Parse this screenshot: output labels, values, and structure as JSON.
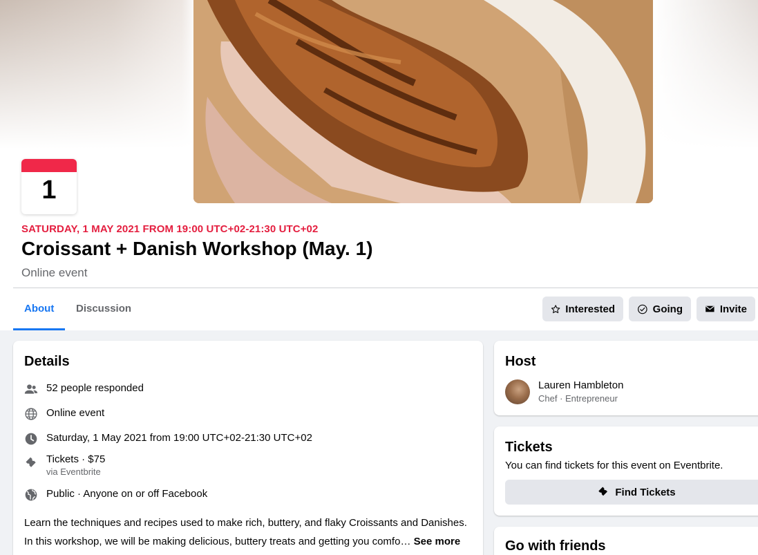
{
  "event": {
    "calendar_day": "1",
    "date_line": "SATURDAY, 1 MAY 2021 FROM 19:00 UTC+02-21:30 UTC+02",
    "title": "Croissant + Danish Workshop (May. 1)",
    "type": "Online event",
    "cover_icon": "croissant-cover-photo"
  },
  "tabs": [
    {
      "label": "About",
      "active": true
    },
    {
      "label": "Discussion",
      "active": false
    }
  ],
  "actions": {
    "interested": {
      "label": "Interested",
      "icon": "star-icon"
    },
    "going": {
      "label": "Going",
      "icon": "check-circle-icon"
    },
    "invite": {
      "label": "Invite",
      "icon": "envelope-icon"
    }
  },
  "details": {
    "title": "Details",
    "rows": [
      {
        "icon": "people-icon",
        "text": "52 people responded"
      },
      {
        "icon": "globe-icon",
        "text": "Online event"
      },
      {
        "icon": "clock-icon",
        "text": "Saturday, 1 May 2021 from 19:00 UTC+02-21:30 UTC+02"
      },
      {
        "icon": "ticket-icon",
        "text": "Tickets · $75",
        "sub": "via Eventbrite"
      },
      {
        "icon": "public-globe-icon",
        "text": "Public · Anyone on or off Facebook"
      }
    ],
    "description_line1": "Learn the techniques and recipes used to make rich, buttery, and flaky Croissants and Danishes.",
    "description_line2": "In this workshop, we will be making delicious, buttery treats and getting you comfo…",
    "see_more": "See more"
  },
  "host": {
    "title": "Host",
    "name": "Lauren Hambleton",
    "role": "Chef · Entrepreneur"
  },
  "tickets": {
    "title": "Tickets",
    "text": "You can find tickets for this event on Eventbrite.",
    "button": "Find Tickets"
  },
  "friends": {
    "title": "Go with friends"
  },
  "colors": {
    "accent": "#1877f2",
    "date_red": "#e41e3f",
    "calendar_band": "#f02849",
    "secondary_text": "#65676b",
    "button_bg": "#e4e6eb"
  }
}
